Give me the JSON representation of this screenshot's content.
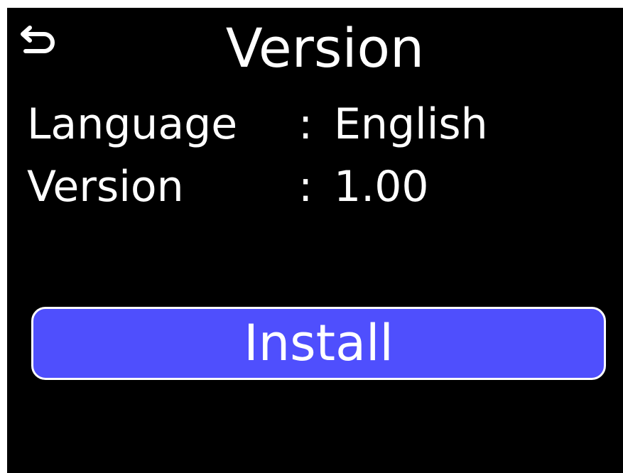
{
  "header": {
    "back_icon": "back-arrow-icon",
    "title": "Version"
  },
  "info": {
    "rows": [
      {
        "label": "Language",
        "separator": ":",
        "value": "English"
      },
      {
        "label": "Version",
        "separator": ":",
        "value": "1.00"
      }
    ]
  },
  "actions": {
    "install_label": "Install"
  },
  "colors": {
    "background": "#000000",
    "text": "#ffffff",
    "button_fill": "#4f4ffd",
    "button_border": "#ffffff"
  }
}
